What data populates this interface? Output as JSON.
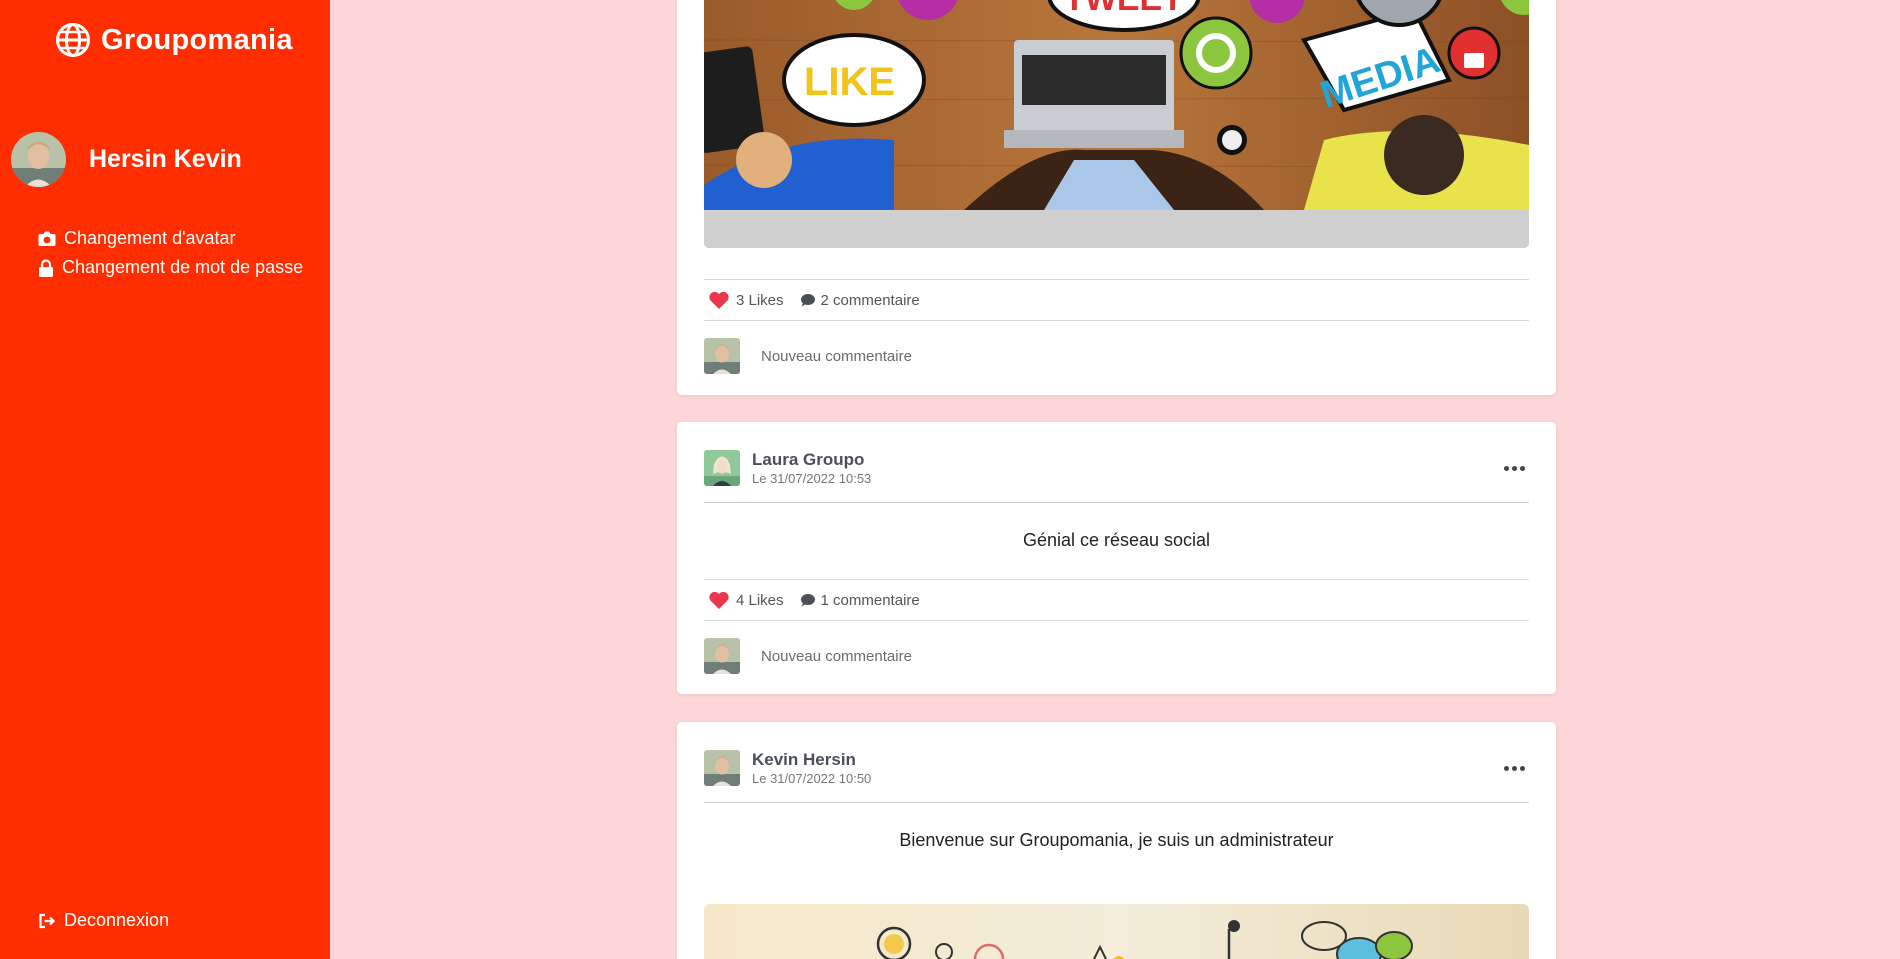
{
  "app": {
    "name": "Groupomania",
    "brand_icon": "globe-icon",
    "accent_color": "#ff2d00",
    "background_color": "#fdd7d7"
  },
  "user": {
    "name": "Hersin Kevin"
  },
  "sidebar": {
    "menu": [
      {
        "label": "Changement d'avatar",
        "icon": "camera-icon"
      },
      {
        "label": "Changement de mot de passe",
        "icon": "lock-icon"
      }
    ],
    "logout_label": "Deconnexion",
    "logout_icon": "sign-out-icon"
  },
  "posts": [
    {
      "image": "social media illustration",
      "likes": "3 Likes",
      "comments": "2 commentaire",
      "comment_placeholder": "Nouveau commentaire"
    },
    {
      "author": "Laura Groupo",
      "date": "Le 31/07/2022 10:53",
      "text": "Génial ce réseau social",
      "likes": "4 Likes",
      "comments": "1 commentaire",
      "comment_placeholder": "Nouveau commentaire"
    },
    {
      "author": "Kevin Hersin",
      "date": "Le 31/07/2022 10:50",
      "text": "Bienvenue sur Groupomania, je suis un administrateur"
    }
  ]
}
